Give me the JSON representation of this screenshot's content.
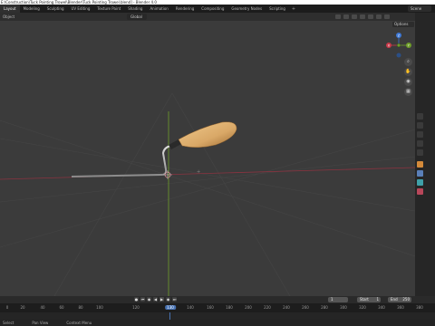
{
  "window": {
    "title": "E:\\Construction\\Tuck Pointing Trowel\\Blender\\Tuck Pointing Trowel.blend] - Blender 4.0"
  },
  "workspaces": {
    "tabs": [
      "Layout",
      "Modeling",
      "Sculpting",
      "UV Editing",
      "Texture Paint",
      "Shading",
      "Animation",
      "Rendering",
      "Compositing",
      "Geometry Nodes",
      "Scripting"
    ],
    "active_index": 0,
    "add_label": "+",
    "scene_label": "Scene"
  },
  "viewport_header": {
    "mode_label": "Object",
    "orientation_label": "Global",
    "options_label": "Options"
  },
  "gizmo": {
    "x_label": "X",
    "y_label": "Y",
    "z_label": "Z"
  },
  "timeline": {
    "start_label": "Start",
    "start_value": "1",
    "end_label": "End",
    "end_value": "250",
    "current_frame": "1",
    "ticks": [
      "0",
      "20",
      "40",
      "60",
      "80",
      "100",
      "120",
      "130",
      "140",
      "160",
      "180",
      "200",
      "220",
      "240",
      "260",
      "280",
      "300",
      "320",
      "340",
      "360",
      "380"
    ],
    "current_tick": "130",
    "current_tick_label": "130"
  },
  "statusbar": {
    "items": [
      "Select",
      "Pan View",
      "Context Menu"
    ]
  },
  "colors": {
    "x_axis": "#c83a4a",
    "y_axis": "#6f9e2a",
    "z_axis": "#3f79d6",
    "accent": "#4772b3",
    "handle_wood": "#d9a867"
  }
}
